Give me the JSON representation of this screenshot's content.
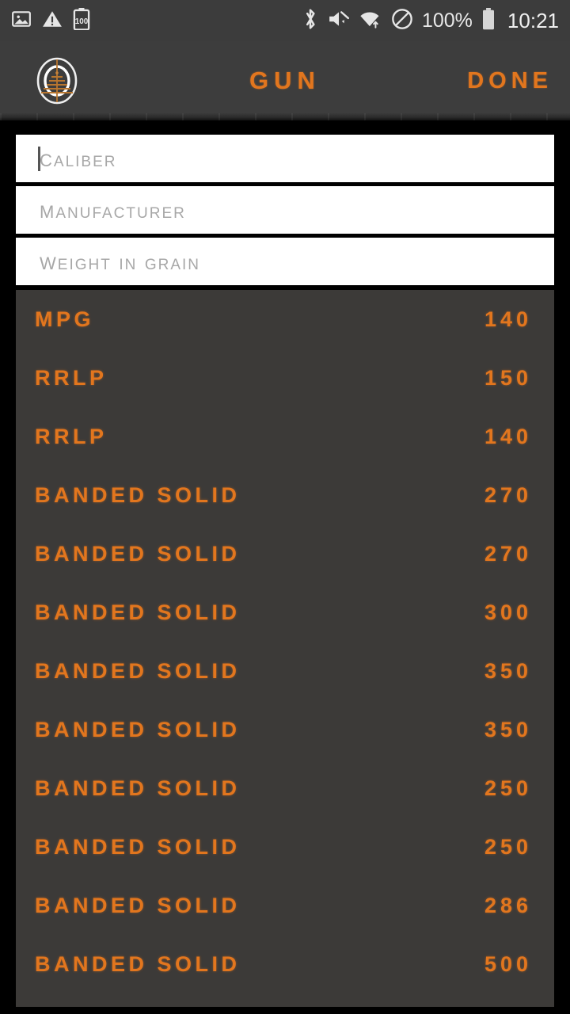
{
  "status_bar": {
    "left_icons": [
      "image-icon",
      "warning-icon",
      "battery-saver-100-icon"
    ],
    "battery_badge": "100",
    "right_icons": [
      "bluetooth-icon",
      "volume-mute-icon",
      "wifi-icon",
      "do-not-disturb-icon",
      "battery-icon"
    ],
    "battery_percent": "100%",
    "clock": "10:21"
  },
  "appbar": {
    "logo_icon": "scope-reticle-logo",
    "title": "GUN",
    "action_label": "DONE",
    "accent_color": "#e2761e",
    "background_color": "#3d3d3d"
  },
  "form": {
    "fields": [
      {
        "name": "caliber",
        "placeholder": "Caliber",
        "value": "",
        "focused": true
      },
      {
        "name": "manufacturer",
        "placeholder": "Manufacturer",
        "value": "",
        "focused": false
      },
      {
        "name": "weight",
        "placeholder": "Weight in grain",
        "value": "",
        "focused": false
      }
    ]
  },
  "ammo_list": {
    "background_color": "#3c3a38",
    "text_color": "#e2761e",
    "rows": [
      {
        "name": "MPG",
        "weight": "140"
      },
      {
        "name": "RRLP",
        "weight": "150"
      },
      {
        "name": "RRLP",
        "weight": "140"
      },
      {
        "name": "BANDED SOLID",
        "weight": "270"
      },
      {
        "name": "BANDED SOLID",
        "weight": "270"
      },
      {
        "name": "BANDED SOLID",
        "weight": "300"
      },
      {
        "name": "BANDED SOLID",
        "weight": "350"
      },
      {
        "name": "BANDED SOLID",
        "weight": "350"
      },
      {
        "name": "BANDED SOLID",
        "weight": "250"
      },
      {
        "name": "BANDED SOLID",
        "weight": "250"
      },
      {
        "name": "BANDED SOLID",
        "weight": "286"
      },
      {
        "name": "BANDED SOLID",
        "weight": "500"
      }
    ]
  }
}
